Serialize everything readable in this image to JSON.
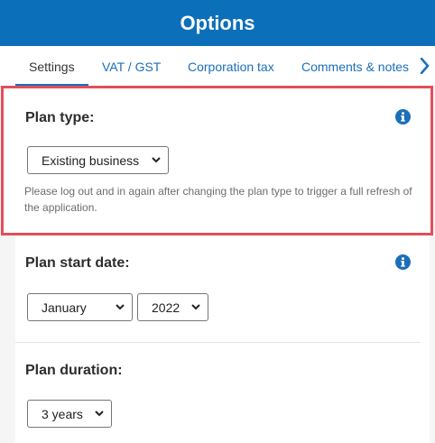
{
  "header": {
    "title": "Options"
  },
  "tabs": [
    {
      "label": "Settings"
    },
    {
      "label": "VAT / GST"
    },
    {
      "label": "Corporation tax"
    },
    {
      "label": "Comments & notes"
    }
  ],
  "plan_type": {
    "title": "Plan type:",
    "selected": "Existing business",
    "note": "Please log out and in again after changing the plan type to trigger a full refresh of the application."
  },
  "plan_start_date": {
    "title": "Plan start date:",
    "month": "January",
    "year": "2022"
  },
  "plan_duration": {
    "title": "Plan duration:",
    "selected": "3 years"
  },
  "colors": {
    "header": "#0c6fba",
    "link": "#1a6fb8",
    "highlight_border": "#e0505a"
  },
  "icons": {
    "info": "info-circle-icon",
    "next": "chevron-right-icon",
    "dropdown": "chevron-down-icon"
  }
}
